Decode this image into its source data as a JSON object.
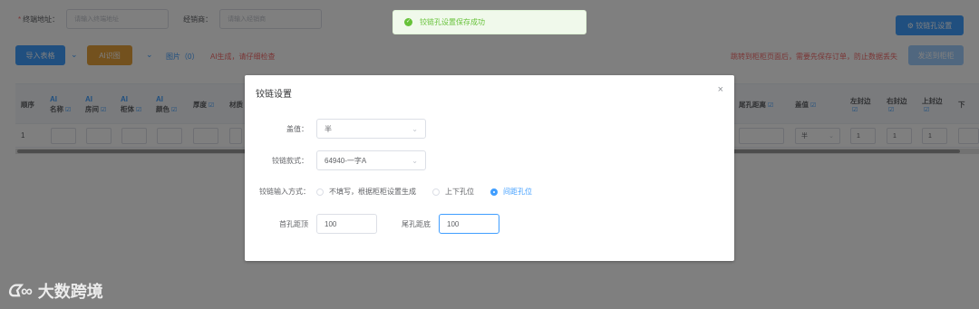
{
  "filters": {
    "terminal_label": "终端地址：",
    "terminal_required": "*",
    "terminal_placeholder": "请输入终端地址",
    "dealer_label": "经销商：",
    "dealer_placeholder": "请输入经销商"
  },
  "toolbar": {
    "hinge_settings": "⚙ 铰链孔设置",
    "import_table": "导入表格",
    "ai_recognize": "AI识图",
    "image_link": "图片（0）",
    "ai_warning": "AI生成，请仔细检查",
    "jump_warning": "跳转到柜柜页面后，需要先保存订单，防止数据丢失",
    "send_cabinet": "发送到柜柜"
  },
  "table": {
    "columns": [
      {
        "label": "顺序",
        "ai": false,
        "edit": false
      },
      {
        "label": "名称",
        "ai": true,
        "edit": true
      },
      {
        "label": "房间",
        "ai": true,
        "edit": true
      },
      {
        "label": "柜体",
        "ai": true,
        "edit": true
      },
      {
        "label": "颜色",
        "ai": true,
        "edit": true
      },
      {
        "label": "厚度",
        "ai": false,
        "edit": true
      },
      {
        "label": "材质",
        "ai": false,
        "edit": false
      },
      {
        "label": "尾孔距离",
        "ai": false,
        "edit": true
      },
      {
        "label": "盖值",
        "ai": false,
        "edit": true
      },
      {
        "label": "左封边",
        "ai": false,
        "edit": true
      },
      {
        "label": "右封边",
        "ai": false,
        "edit": true
      },
      {
        "label": "上封边",
        "ai": false,
        "edit": true
      },
      {
        "label": "下",
        "ai": false,
        "edit": false
      }
    ],
    "ai_tag": "AI",
    "edit_icon": "☑",
    "row": {
      "index": "1",
      "cover": "半",
      "left": "1",
      "right": "1",
      "top": "1"
    }
  },
  "toast": {
    "message": "铰链孔设置保存成功",
    "icon": "✓"
  },
  "dialog": {
    "title": "铰链设置",
    "close": "×",
    "cover_label": "盖值：",
    "cover_value": "半",
    "style_label": "铰链款式：",
    "style_value": "64940-一字A",
    "input_mode_label": "铰链输入方式：",
    "options": [
      {
        "label": "不填写，根据柜柜设置生成",
        "checked": false
      },
      {
        "label": "上下孔位",
        "checked": false
      },
      {
        "label": "间距孔位",
        "checked": true
      }
    ],
    "first_hole_label": "首孔距顶",
    "first_hole_value": "100",
    "last_hole_label": "尾孔距底",
    "last_hole_value": "100"
  },
  "watermark": {
    "logo": "ᗧ∞",
    "text": "大数跨境"
  },
  "colors": {
    "primary": "#409eff",
    "warning": "#e6a23c",
    "success": "#67c23a",
    "danger": "#f56c6c"
  }
}
